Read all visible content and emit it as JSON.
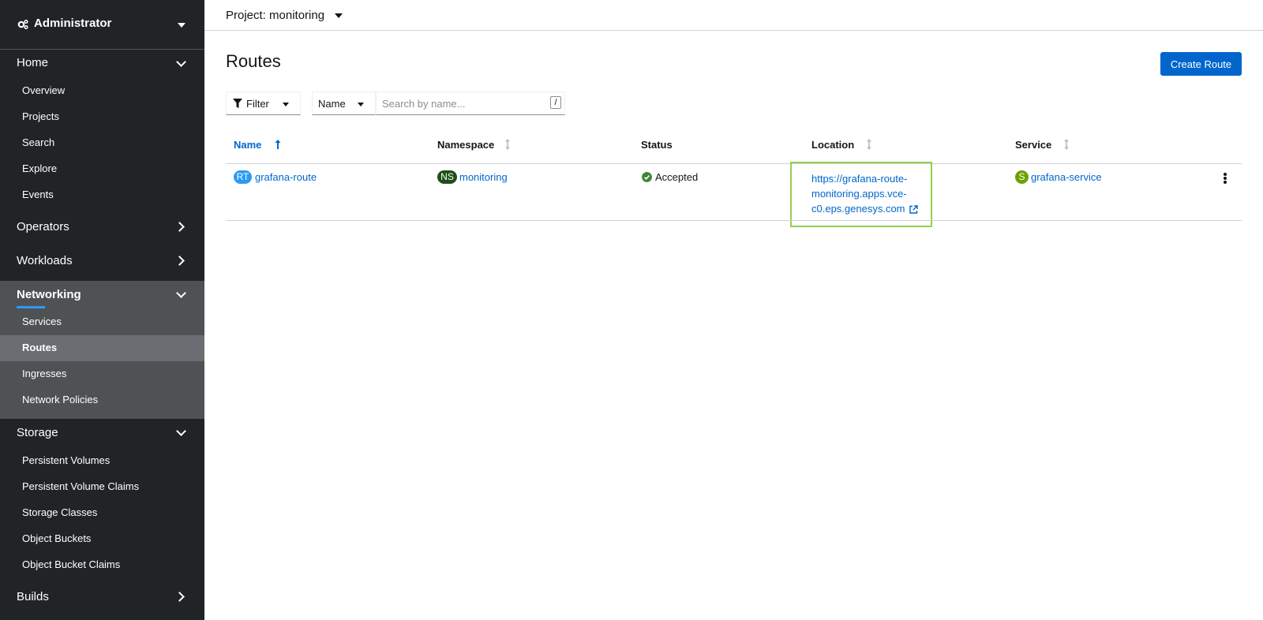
{
  "sidebar": {
    "perspective": "Administrator",
    "home": {
      "label": "Home",
      "items": [
        "Overview",
        "Projects",
        "Search",
        "Explore",
        "Events"
      ]
    },
    "operators": "Operators",
    "workloads": "Workloads",
    "networking": {
      "label": "Networking",
      "items": [
        "Services",
        "Routes",
        "Ingresses",
        "Network Policies"
      ],
      "active": "Routes"
    },
    "storage": {
      "label": "Storage",
      "items": [
        "Persistent Volumes",
        "Persistent Volume Claims",
        "Storage Classes",
        "Object Buckets",
        "Object Bucket Claims"
      ]
    },
    "builds": "Builds"
  },
  "topbar": {
    "project": "Project: monitoring"
  },
  "page": {
    "title": "Routes",
    "create_label": "Create Route"
  },
  "toolbar": {
    "filter_label": "Filter",
    "field_label": "Name",
    "search_placeholder": "Search by name...",
    "shortcut": "/"
  },
  "table": {
    "columns": {
      "name": "Name",
      "namespace": "Namespace",
      "status": "Status",
      "location": "Location",
      "service": "Service"
    },
    "rows": [
      {
        "name_badge": "RT",
        "name": "grafana-route",
        "ns_badge": "NS",
        "namespace": "monitoring",
        "status": "Accepted",
        "location_lines": [
          "https://grafana-route-",
          "monitoring.apps.vce-",
          "c0.eps.genesys.com"
        ],
        "svc_badge": "S",
        "service": "grafana-service"
      }
    ]
  },
  "colors": {
    "accent": "#0066cc",
    "sidebar": "#212427",
    "highlight": "#92d050",
    "route_badge": "#2b9af3",
    "ns_badge": "#1e4f18",
    "svc_badge": "#6ca100"
  },
  "icons": [
    "cogs-icon",
    "caret-down-icon",
    "chevron-down-icon",
    "chevron-right-icon",
    "filter-icon",
    "sort-asc-icon",
    "sort-icon",
    "check-circle-icon",
    "external-link-icon",
    "kebab-icon"
  ]
}
